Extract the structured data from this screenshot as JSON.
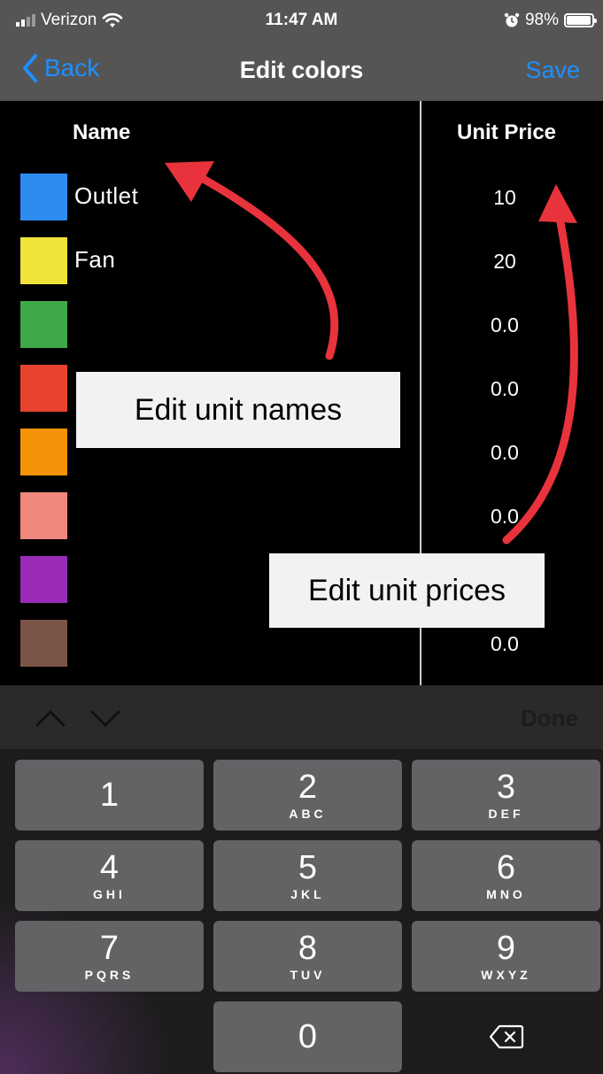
{
  "status_bar": {
    "carrier": "Verizon",
    "time": "11:47 AM",
    "battery": "98%"
  },
  "nav": {
    "back_label": "Back",
    "title": "Edit colors",
    "save_label": "Save"
  },
  "table": {
    "name_header": "Name",
    "price_header": "Unit Price",
    "rows": [
      {
        "color": "#2E8CF0",
        "name": "Outlet",
        "price": "10"
      },
      {
        "color": "#F0E43A",
        "name": "Fan",
        "price": "20"
      },
      {
        "color": "#3FA94A",
        "name": "",
        "price": "0.0"
      },
      {
        "color": "#E8432E",
        "name": "",
        "price": "0.0"
      },
      {
        "color": "#F29307",
        "name": "",
        "price": "0.0"
      },
      {
        "color": "#F0887D",
        "name": "",
        "price": "0.0"
      },
      {
        "color": "#9A2BB8",
        "name": "",
        "price": ""
      },
      {
        "color": "#7A5446",
        "name": "",
        "price": "0.0"
      }
    ]
  },
  "callouts": {
    "names": "Edit unit names",
    "prices": "Edit unit prices"
  },
  "keyboard": {
    "done_label": "Done",
    "keys": [
      {
        "num": "1",
        "letters": ""
      },
      {
        "num": "2",
        "letters": "ABC"
      },
      {
        "num": "3",
        "letters": "DEF"
      },
      {
        "num": "4",
        "letters": "GHI"
      },
      {
        "num": "5",
        "letters": "JKL"
      },
      {
        "num": "6",
        "letters": "MNO"
      },
      {
        "num": "7",
        "letters": "PQRS"
      },
      {
        "num": "8",
        "letters": "TUV"
      },
      {
        "num": "9",
        "letters": "WXYZ"
      },
      {
        "num": "0",
        "letters": ""
      }
    ]
  },
  "accent_color": "#1E90FF",
  "arrow_color": "#E8333C"
}
